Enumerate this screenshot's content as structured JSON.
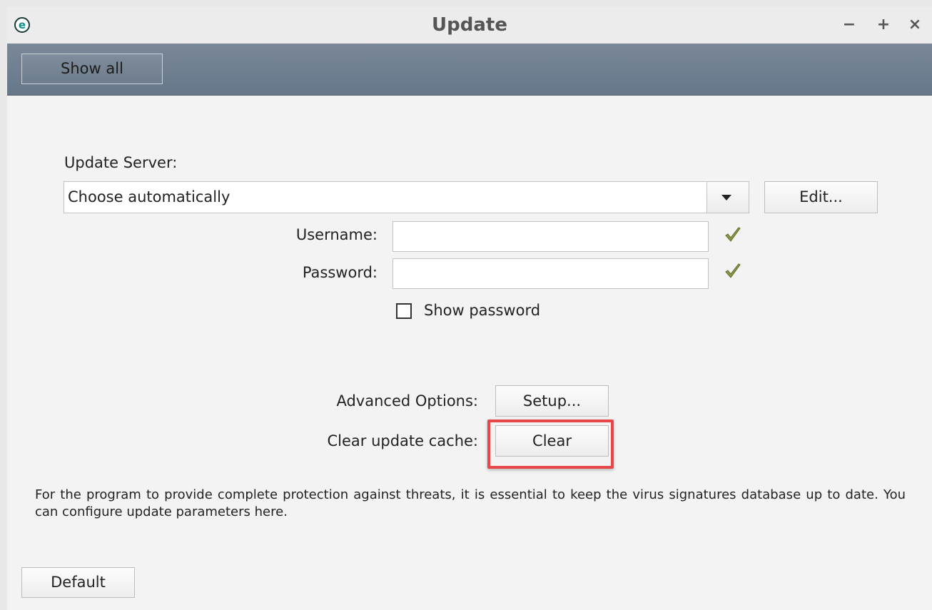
{
  "window": {
    "title": "Update",
    "app_icon_letter": "e",
    "controls": {
      "minimize": "−",
      "maximize": "+",
      "close": "×"
    }
  },
  "toolbar": {
    "show_all_label": "Show all"
  },
  "update_server": {
    "label": "Update Server:",
    "selected_value": "Choose automatically",
    "edit_label": "Edit..."
  },
  "credentials": {
    "username_label": "Username:",
    "username_value": "",
    "password_label": "Password:",
    "password_value": "",
    "show_password_label": "Show password",
    "show_password_checked": false
  },
  "advanced": {
    "label": "Advanced Options:",
    "setup_label": "Setup..."
  },
  "cache": {
    "label": "Clear update cache:",
    "clear_label": "Clear"
  },
  "description": "For the program to provide complete protection against threats, it is essential to keep the virus signatures database up to date. You can configure update parameters here.",
  "footer": {
    "default_label": "Default"
  },
  "colors": {
    "toolbar": "#6e7d8d",
    "highlight": "#e8474a",
    "check": "#7a8a3a"
  },
  "icons": {
    "app": "eset-logo-icon",
    "combo": "dropdown-arrow-icon",
    "valid": "checkmark-icon"
  }
}
